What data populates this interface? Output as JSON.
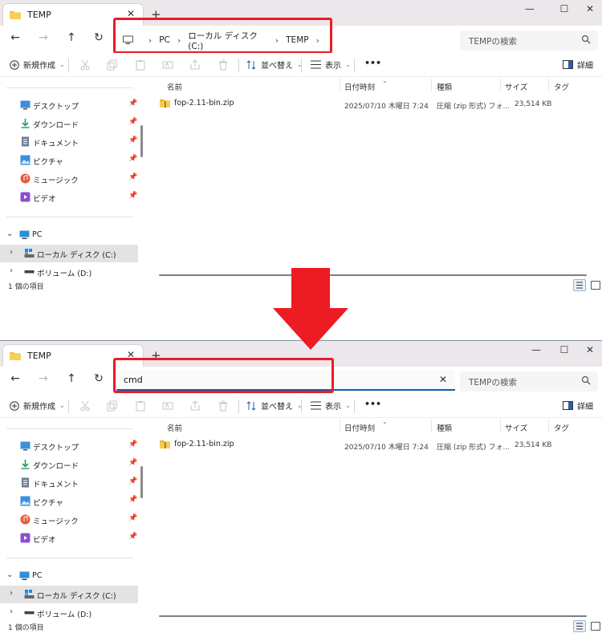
{
  "tab": {
    "title": "TEMP",
    "close": "✕",
    "new_tab": "+"
  },
  "window_controls": {
    "minimize": "—",
    "maximize": "☐",
    "close": "✕"
  },
  "nav_buttons": {
    "back": "←",
    "forward": "→",
    "up": "↑",
    "refresh": "↻"
  },
  "breadcrumb": {
    "items": [
      "PC",
      "ローカル ディスク (C:)",
      "TEMP"
    ],
    "separator": "›"
  },
  "address_edit": {
    "value": "cmd",
    "clear": "✕"
  },
  "search": {
    "placeholder": "TEMPの検索"
  },
  "toolbar": {
    "new_label": "新規作成",
    "sort_label": "並べ替え",
    "view_label": "表示",
    "more_label": "•••",
    "details_label": "詳細"
  },
  "nav_pane": {
    "quick_access": [
      {
        "label": "デスクトップ",
        "icon": "desktop-icon"
      },
      {
        "label": "ダウンロード",
        "icon": "download-icon"
      },
      {
        "label": "ドキュメント",
        "icon": "document-icon"
      },
      {
        "label": "ピクチャ",
        "icon": "picture-icon"
      },
      {
        "label": "ミュージック",
        "icon": "music-icon"
      },
      {
        "label": "ビデオ",
        "icon": "video-icon"
      }
    ],
    "pc_label": "PC",
    "drives": [
      "ローカル ディスク (C:)",
      "ボリューム (D:)"
    ]
  },
  "columns": {
    "name": "名前",
    "date": "日付時刻",
    "type": "種類",
    "size": "サイズ",
    "tag": "タグ"
  },
  "files": [
    {
      "name": "fop-2.11-bin.zip",
      "date": "2025/07/10 木曜日 7:24",
      "type": "圧縮 (zip 形式) フォ...",
      "size": "23,514 KB"
    }
  ],
  "status": {
    "item_count": "1 個の項目"
  },
  "colors": {
    "highlight": "#ec1b24",
    "accent": "#0a5fb4",
    "folder": "#f2c03a"
  }
}
